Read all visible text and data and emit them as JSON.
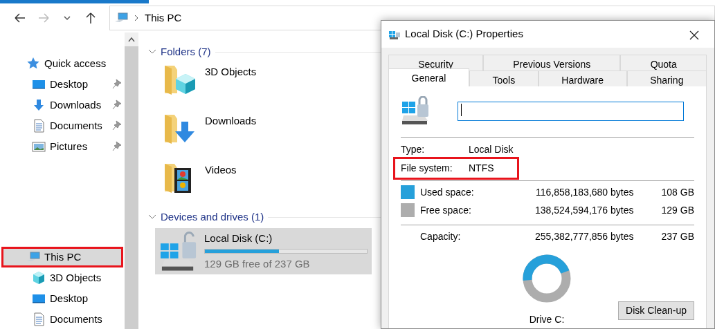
{
  "address": {
    "path": "This PC"
  },
  "sidebar": {
    "items": [
      {
        "label": "Quick access",
        "kind": "star",
        "children": [
          {
            "label": "Desktop",
            "kind": "desktop",
            "pinned": true
          },
          {
            "label": "Downloads",
            "kind": "downloads",
            "pinned": true
          },
          {
            "label": "Documents",
            "kind": "documents",
            "pinned": true
          },
          {
            "label": "Pictures",
            "kind": "pictures",
            "pinned": true
          }
        ]
      },
      {
        "label": "This PC",
        "kind": "pc",
        "highlighted": true,
        "children": [
          {
            "label": "3D Objects",
            "kind": "cube",
            "pinned": false
          },
          {
            "label": "Desktop",
            "kind": "desktop",
            "pinned": false
          },
          {
            "label": "Documents",
            "kind": "documents",
            "pinned": false
          }
        ]
      }
    ]
  },
  "sections": [
    {
      "title": "Folders (7)",
      "expanded": true,
      "kind": "folders",
      "items": [
        {
          "label": "3D Objects",
          "kind": "cube"
        },
        {
          "label": "Downloads",
          "kind": "downloads"
        },
        {
          "label": "Videos",
          "kind": "videos"
        }
      ]
    },
    {
      "title": "Devices and drives (1)",
      "expanded": true,
      "kind": "drives",
      "items": [
        {
          "label": "Local Disk (C:)",
          "level": 0.456,
          "caption": "129 GB free of 237 GB",
          "selected": true
        }
      ]
    }
  ],
  "dialog": {
    "title": "Local Disk (C:) Properties",
    "tab_rows": [
      {
        "tabs": [
          {
            "label": "Security",
            "selected": false
          },
          {
            "label": "Previous Versions",
            "selected": false
          },
          {
            "label": "Quota",
            "selected": false
          }
        ]
      },
      {
        "tabs": [
          {
            "label": "General",
            "selected": true
          },
          {
            "label": "Tools",
            "selected": false
          },
          {
            "label": "Hardware",
            "selected": false
          },
          {
            "label": "Sharing",
            "selected": false
          }
        ]
      }
    ],
    "name_field": {
      "focused": true
    },
    "properties": [
      {
        "label": "Type:",
        "value": "Local Disk"
      },
      {
        "label": "File system:",
        "value": "NTFS",
        "highlighted": true
      }
    ],
    "space": [
      {
        "label": "Used space:",
        "bytes": "116,858,183,680 bytes",
        "size": "108 GB",
        "color": "#26a0da"
      },
      {
        "label": "Free space:",
        "bytes": "138,524,594,176 bytes",
        "size": "129 GB",
        "color": "#adadad"
      }
    ],
    "capacity": {
      "label": "Capacity:",
      "bytes": "255,382,777,856 bytes",
      "size": "237 GB"
    },
    "usage": {
      "level": 0.4576
    },
    "drive_label": "Drive C:",
    "button": "Disk Clean-up"
  }
}
